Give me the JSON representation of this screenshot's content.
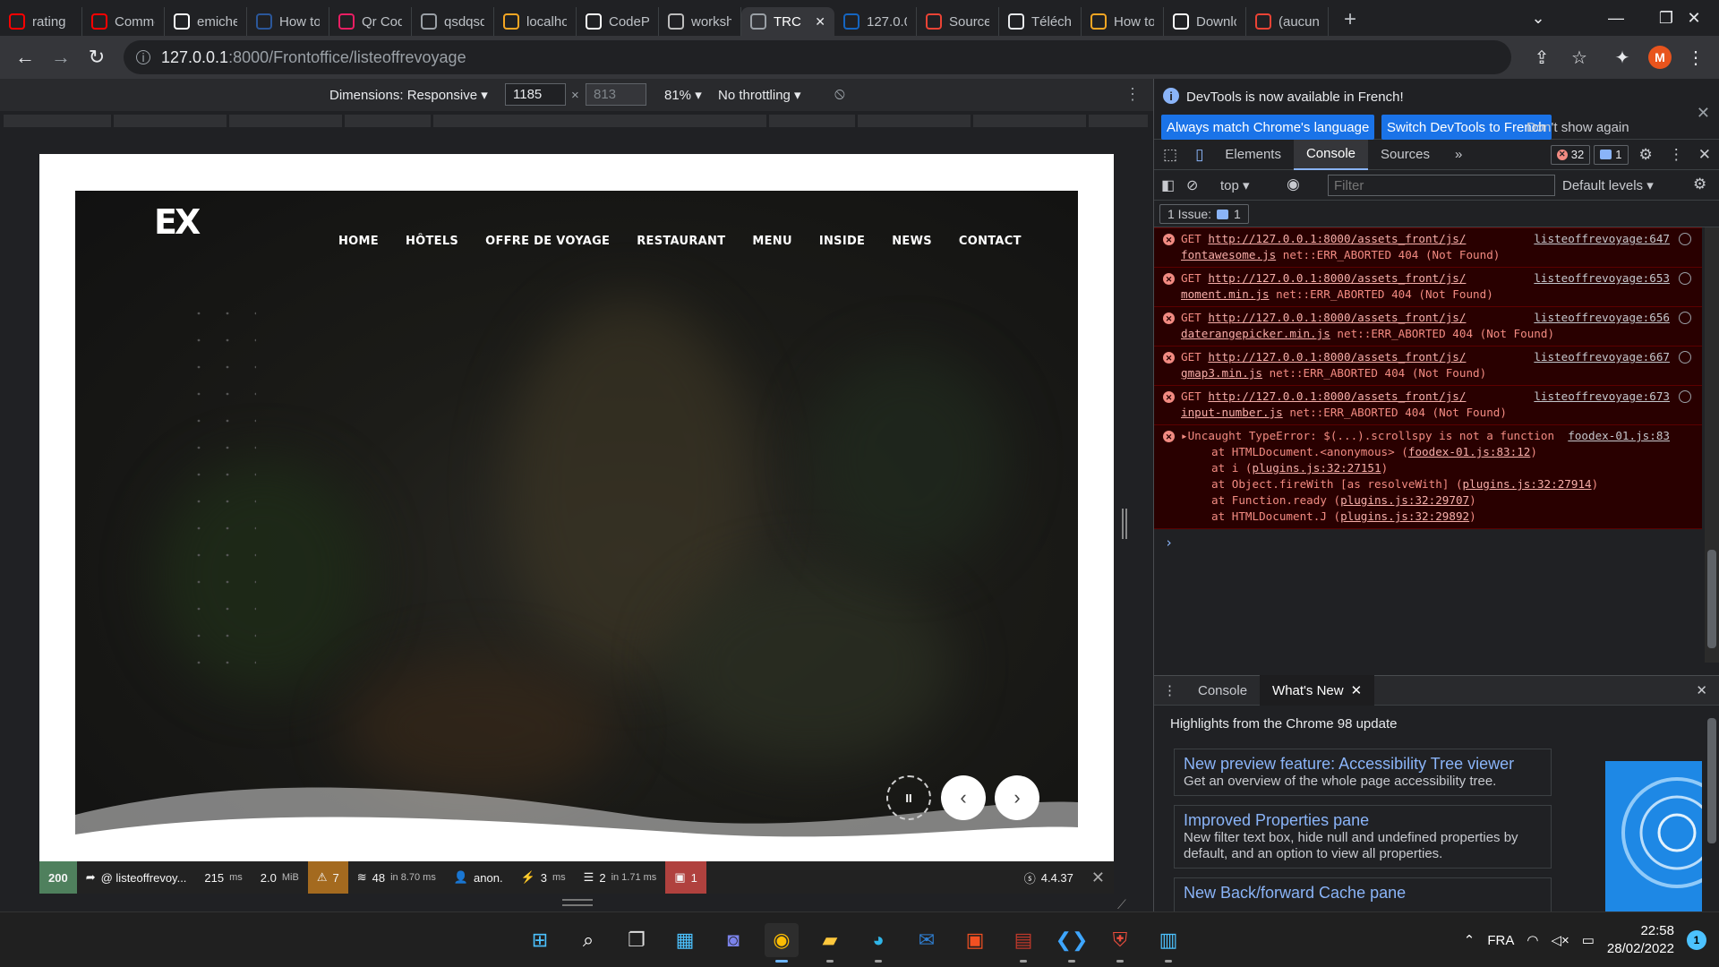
{
  "tabs": [
    {
      "label": "rating",
      "icon": "youtube-icon",
      "color": "#ff0000"
    },
    {
      "label": "Comme",
      "icon": "youtube-icon",
      "color": "#ff0000"
    },
    {
      "label": "emiche",
      "icon": "github-icon",
      "color": "#ffffff"
    },
    {
      "label": "How to",
      "icon": "word-icon",
      "color": "#2b579a"
    },
    {
      "label": "Qr Cod",
      "icon": "qr-icon",
      "color": "#e91e63"
    },
    {
      "label": "qsdqsd",
      "icon": "globe-icon",
      "color": "#9aa0a6"
    },
    {
      "label": "localho",
      "icon": "app-icon",
      "color": "#f5a623"
    },
    {
      "label": "CodePe",
      "icon": "codepen-icon",
      "color": "#ffffff"
    },
    {
      "label": "worksh",
      "icon": "image-icon",
      "color": "#bdbdbd"
    },
    {
      "label": "TRC",
      "icon": "globe-icon",
      "color": "#9aa0a6",
      "active": true
    },
    {
      "label": "127.0.0",
      "icon": "bd-icon",
      "color": "#1565c0"
    },
    {
      "label": "Source",
      "icon": "gmail-icon",
      "color": "#ea4335"
    },
    {
      "label": "Télécha",
      "icon": "download-icon",
      "color": "#e8eaed"
    },
    {
      "label": "How to",
      "icon": "dot-icon",
      "color": "#f5a623"
    },
    {
      "label": "Downlo",
      "icon": "tm-icon",
      "color": "#ffffff"
    },
    {
      "label": "(aucun",
      "icon": "gmail-icon",
      "color": "#ea4335"
    }
  ],
  "address": {
    "host": "127.0.0.1",
    "path": ":8000/Frontoffice/listeoffrevoyage"
  },
  "profile_initial": "M",
  "device_toolbar": {
    "dimensions_label": "Dimensions: Responsive",
    "width": "1185",
    "height": "813",
    "times": "×",
    "zoom": "81%",
    "throttling": "No throttling"
  },
  "site": {
    "logo": "EX",
    "nav": [
      "HOME",
      "HÔTELS",
      "OFFRE DE VOYAGE",
      "RESTAURANT",
      "MENU",
      "INSIDE",
      "NEWS",
      "CONTACT"
    ],
    "pause_label": "II",
    "prev_label": "‹",
    "next_label": "›"
  },
  "sf_toolbar": {
    "status": "200",
    "route": "@ listeoffrevoy...",
    "time": "215",
    "time_unit": "ms",
    "memory": "2.0",
    "memory_unit": "MiB",
    "logs": "7",
    "twig": "48",
    "twig_detail": "in 8.70 ms",
    "user": "anon.",
    "events": "3",
    "events_unit": "ms",
    "db": "2",
    "db_detail": "in 1.71 ms",
    "errors": "1",
    "version": "4.4.37"
  },
  "devtools": {
    "info_text": "DevTools is now available in French!",
    "btn_match": "Always match Chrome's language",
    "btn_switch": "Switch DevTools to French",
    "btn_dismiss": "Don't show again",
    "tabs": [
      "Elements",
      "Console",
      "Sources"
    ],
    "error_count": "32",
    "message_count": "1",
    "context": "top",
    "filter_placeholder": "Filter",
    "levels": "Default levels",
    "issues_label": "1 Issue:",
    "issues_count": "1",
    "messages": [
      {
        "method": "GET",
        "url": "http://127.0.0.1:8000/assets_front/js/",
        "file": "fontawesome.js",
        "error": "net::ERR_ABORTED 404 (Not Found)",
        "source": "listeoffrevoyage:647"
      },
      {
        "method": "GET",
        "url": "http://127.0.0.1:8000/assets_front/js/",
        "file": "moment.min.js",
        "error": "net::ERR_ABORTED 404 (Not Found)",
        "source": "listeoffrevoyage:653"
      },
      {
        "method": "GET",
        "url": "http://127.0.0.1:8000/assets_front/js/",
        "file": "daterangepicker.min.js",
        "error": "net::ERR_ABORTED 404 (Not Found)",
        "source": "listeoffrevoyage:656"
      },
      {
        "method": "GET",
        "url": "http://127.0.0.1:8000/assets_front/js/",
        "file": "gmap3.min.js",
        "error": "net::ERR_ABORTED 404 (Not Found)",
        "source": "listeoffrevoyage:667"
      },
      {
        "method": "GET",
        "url": "http://127.0.0.1:8000/assets_front/js/",
        "file": "input-number.js",
        "error": "net::ERR_ABORTED 404 (Not Found)",
        "source": "listeoffrevoyage:673"
      }
    ],
    "exception": {
      "text": "Uncaught TypeError: $(...).scrollspy is not a function",
      "source": "foodex-01.js:83",
      "stack": [
        {
          "prefix": "at HTMLDocument.<anonymous> (",
          "loc": "foodex-01.js:83:12",
          "suffix": ")"
        },
        {
          "prefix": "at i (",
          "loc": "plugins.js:32:27151",
          "suffix": ")"
        },
        {
          "prefix": "at Object.fireWith [as resolveWith] (",
          "loc": "plugins.js:32:27914",
          "suffix": ")"
        },
        {
          "prefix": "at Function.ready (",
          "loc": "plugins.js:32:29707",
          "suffix": ")"
        },
        {
          "prefix": "at HTMLDocument.J (",
          "loc": "plugins.js:32:29892",
          "suffix": ")"
        }
      ]
    },
    "drawer_tabs": [
      "Console",
      "What's New"
    ],
    "highlights": "Highlights from the Chrome 98 update",
    "cards": [
      {
        "title": "New preview feature: Accessibility Tree viewer",
        "desc": "Get an overview of the whole page accessibility tree."
      },
      {
        "title": "Improved Properties pane",
        "desc": "New filter text box, hide null and undefined properties by default, and an option to view all properties."
      },
      {
        "title": "New Back/forward Cache pane",
        "desc": ""
      }
    ]
  },
  "taskbar": {
    "lang": "FRA",
    "time": "22:58",
    "date": "28/02/2022",
    "notifications": "1"
  }
}
